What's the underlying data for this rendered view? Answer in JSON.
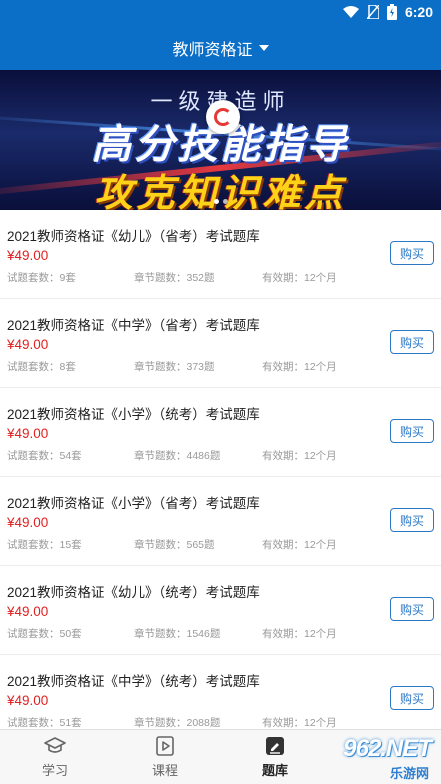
{
  "status_bar": {
    "time": "6:20"
  },
  "header": {
    "title": "教师资格证"
  },
  "banner": {
    "line1": "一级建造师",
    "line2": "高分技能指导",
    "line3": "攻克知识难点"
  },
  "items": [
    {
      "name": "2021教师资格证《幼儿》（省考）考试题库",
      "price": "¥49.00",
      "sets": "试题套数：9套",
      "chapters": "章节题数：352题",
      "validity": "有效期：12个月",
      "buy": "购买"
    },
    {
      "name": "2021教师资格证《中学》（省考）考试题库",
      "price": "¥49.00",
      "sets": "试题套数：8套",
      "chapters": "章节题数：373题",
      "validity": "有效期：12个月",
      "buy": "购买"
    },
    {
      "name": "2021教师资格证《小学》（统考）考试题库",
      "price": "¥49.00",
      "sets": "试题套数：54套",
      "chapters": "章节题数：4486题",
      "validity": "有效期：12个月",
      "buy": "购买"
    },
    {
      "name": "2021教师资格证《小学》（省考）考试题库",
      "price": "¥49.00",
      "sets": "试题套数：15套",
      "chapters": "章节题数：565题",
      "validity": "有效期：12个月",
      "buy": "购买"
    },
    {
      "name": "2021教师资格证《幼儿》（统考）考试题库",
      "price": "¥49.00",
      "sets": "试题套数：50套",
      "chapters": "章节题数：1546题",
      "validity": "有效期：12个月",
      "buy": "购买"
    },
    {
      "name": "2021教师资格证《中学》（统考）考试题库",
      "price": "¥49.00",
      "sets": "试题套数：51套",
      "chapters": "章节题数：2088题",
      "validity": "有效期：12个月",
      "buy": "购买"
    }
  ],
  "tabs": [
    {
      "label": "学习",
      "icon": "graduation-cap-icon",
      "active": false
    },
    {
      "label": "课程",
      "icon": "video-play-icon",
      "active": false
    },
    {
      "label": "题库",
      "icon": "edit-pen-icon",
      "active": true
    }
  ],
  "watermark": {
    "text": "962.NET",
    "sub": "乐游网"
  },
  "colors": {
    "primary": "#0b6fc7",
    "price": "#e02020",
    "button": "#2b78c5"
  }
}
